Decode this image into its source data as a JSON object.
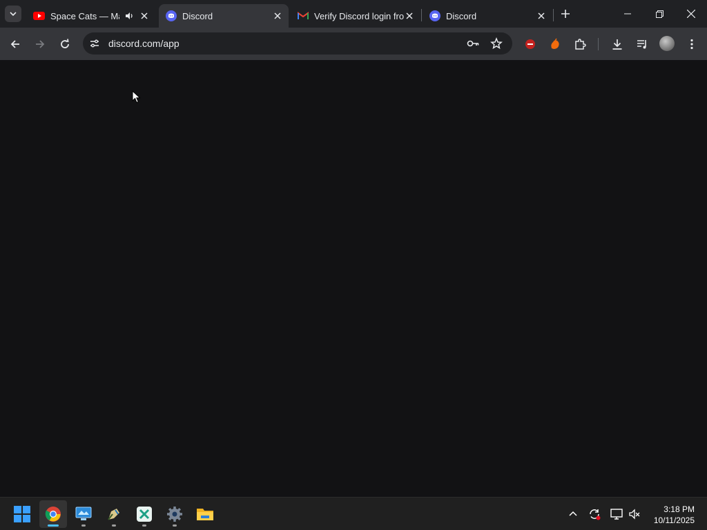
{
  "tabs": [
    {
      "title": "Space Cats — Mag",
      "favicon": "youtube-icon",
      "audio": true,
      "active": false
    },
    {
      "title": "Discord",
      "favicon": "discord-icon",
      "active": true
    },
    {
      "title": "Verify Discord login fro",
      "favicon": "gmail-icon",
      "active": false
    },
    {
      "title": "Discord",
      "favicon": "discord-icon",
      "active": false
    }
  ],
  "address_bar": {
    "url": "discord.com/app"
  },
  "taskbar": {
    "apps": [
      "start-icon",
      "chrome-icon",
      "remote-desktop-icon",
      "pen-app-icon",
      "xbox-app-icon",
      "settings-icon",
      "file-explorer-icon"
    ],
    "time": "3:18 PM",
    "date": "10/11/2025"
  },
  "colors": {
    "page_bg": "#121214",
    "tabstrip_bg": "#202124",
    "toolbar_bg": "#35363a",
    "taskbar_bg": "#202020",
    "discord_blurple": "#5865f2"
  }
}
